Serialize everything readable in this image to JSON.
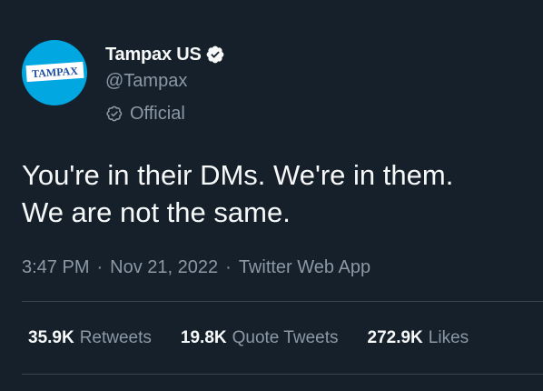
{
  "author": {
    "display_name": "Tampax US",
    "handle": "@Tampax",
    "official_label": "Official",
    "avatar_logo_text": "TAMPAX",
    "verified_icon": "verified-badge-icon",
    "official_icon": "official-check-icon",
    "avatar_bg": "#00a7e1",
    "logo_color": "#1d4fa3"
  },
  "tweet": {
    "text": "You're in their DMs. We're in them.\nWe are not the same.",
    "time": "3:47 PM",
    "date": "Nov 21, 2022",
    "source": "Twitter Web App",
    "separator": "·"
  },
  "stats": {
    "retweets": {
      "count": "35.9K",
      "label": "Retweets"
    },
    "quote_tweets": {
      "count": "19.8K",
      "label": "Quote Tweets"
    },
    "likes": {
      "count": "272.9K",
      "label": "Likes"
    }
  },
  "colors": {
    "background": "#15202b",
    "text_primary": "#f7f9f9",
    "text_secondary": "#8b98a5",
    "divider": "#38444d"
  }
}
